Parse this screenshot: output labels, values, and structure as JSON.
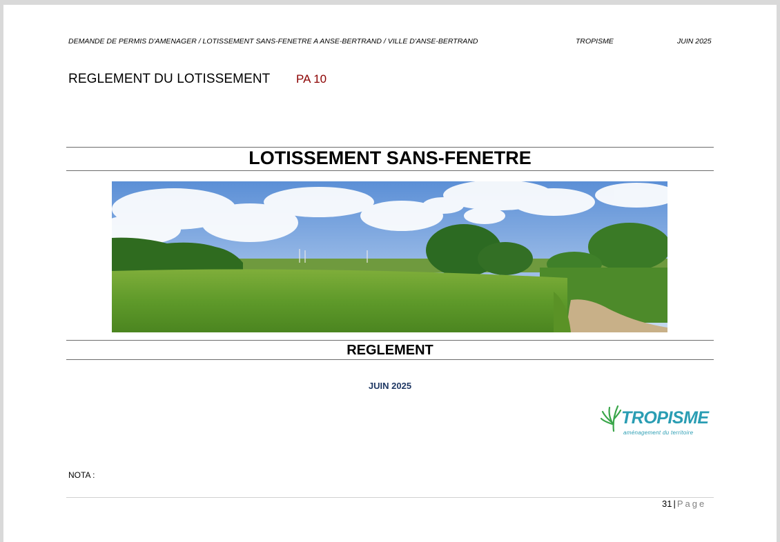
{
  "header": {
    "left": "DEMANDE DE PERMIS D'AMENAGER / LOTISSEMENT SANS-FENETRE A ANSE-BERTRAND / VILLE D'ANSE-BERTRAND",
    "middle": "TROPISME",
    "right": "JUIN 2025"
  },
  "document": {
    "title": "REGLEMENT DU LOTISSEMENT",
    "code": "PA 10"
  },
  "cover": {
    "main_title": "LOTISSEMENT SANS-FENETRE",
    "photo": "landscape-photo",
    "subtitle": "REGLEMENT",
    "date": "JUIN 2025"
  },
  "logo": {
    "name": "TROPISME",
    "tagline": "aménagement du territoire",
    "color": "#2a9db3"
  },
  "nota": "NOTA :",
  "footer": {
    "page_number": "31",
    "separator": "|",
    "page_label": "Page"
  },
  "colors": {
    "code": "#8b0000",
    "date": "#1f3864",
    "brand": "#2a9db3"
  }
}
